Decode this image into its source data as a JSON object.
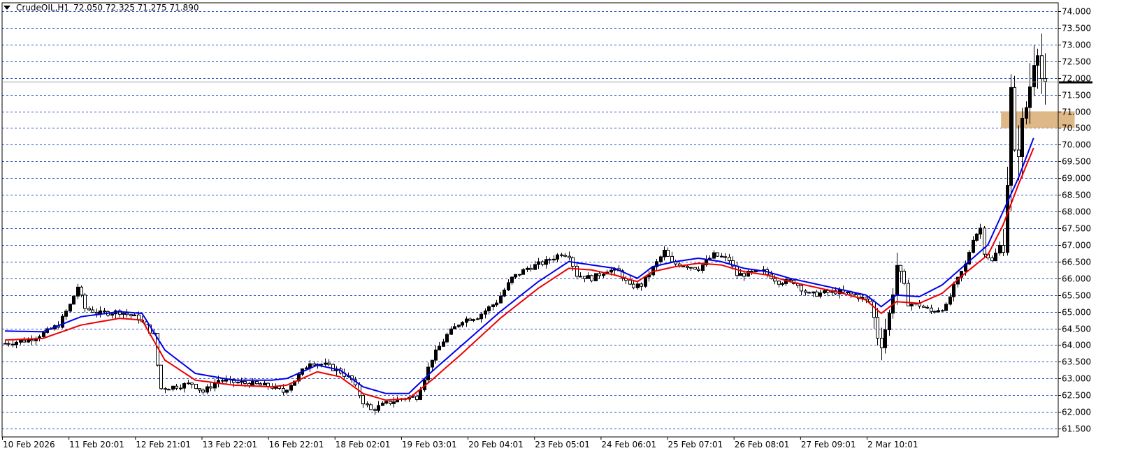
{
  "header": {
    "symbol": "CrudeOIL,H1",
    "ohlc": "72.050 72.325 71.275 71.890"
  },
  "chart_data": {
    "type": "candlestick",
    "symbol": "CrudeOIL",
    "timeframe": "H1",
    "ylim": [
      61.25,
      74.25
    ],
    "y_ticks": [
      "74.000",
      "73.500",
      "73.000",
      "72.500",
      "72.000",
      "71.500",
      "71.000",
      "70.500",
      "70.000",
      "69.500",
      "69.000",
      "68.500",
      "68.000",
      "67.500",
      "67.000",
      "66.500",
      "66.000",
      "65.500",
      "65.000",
      "64.500",
      "64.000",
      "63.500",
      "63.000",
      "62.500",
      "62.000",
      "61.500"
    ],
    "x_ticks": [
      "10 Feb 2026",
      "11 Feb 20:01",
      "12 Feb 21:01",
      "13 Feb 22:01",
      "16 Feb 22:01",
      "18 Feb 02:01",
      "19 Feb 03:01",
      "20 Feb 04:01",
      "23 Feb 05:01",
      "24 Feb 06:01",
      "25 Feb 07:01",
      "26 Feb 08:01",
      "27 Feb 09:01",
      "2 Mar 10:01"
    ],
    "grid": "horizontal dashed",
    "current_price": 71.89,
    "current_price_color": "#000000",
    "zone": {
      "from": 70.5,
      "to": 71.0,
      "start": "1 Mar 23:01",
      "end": "3 Mar 03:01",
      "color": "#deb887"
    },
    "price_path": [
      [
        0,
        64.05
      ],
      [
        6,
        64.15
      ],
      [
        10,
        64.35
      ],
      [
        14,
        64.6
      ],
      [
        17,
        65.2
      ],
      [
        19,
        65.75
      ],
      [
        21,
        65.1
      ],
      [
        25,
        64.95
      ],
      [
        30,
        65.0
      ],
      [
        35,
        64.8
      ],
      [
        39,
        64.3
      ],
      [
        40,
        63.4
      ],
      [
        41,
        62.7
      ],
      [
        44,
        62.75
      ],
      [
        49,
        62.85
      ],
      [
        52,
        62.6
      ],
      [
        56,
        62.95
      ],
      [
        59,
        62.9
      ],
      [
        64,
        62.85
      ],
      [
        70,
        62.75
      ],
      [
        73,
        62.6
      ],
      [
        76,
        62.95
      ],
      [
        80,
        63.5
      ],
      [
        84,
        63.4
      ],
      [
        88,
        63.2
      ],
      [
        91,
        62.95
      ],
      [
        94,
        62.3
      ],
      [
        96,
        62.05
      ],
      [
        100,
        62.25
      ],
      [
        104,
        62.4
      ],
      [
        108,
        62.45
      ],
      [
        112,
        63.6
      ],
      [
        116,
        64.3
      ],
      [
        120,
        64.75
      ],
      [
        124,
        64.85
      ],
      [
        129,
        65.3
      ],
      [
        133,
        66.0
      ],
      [
        137,
        66.3
      ],
      [
        142,
        66.5
      ],
      [
        146,
        66.75
      ],
      [
        148,
        66.7
      ],
      [
        150,
        66.1
      ],
      [
        154,
        66.0
      ],
      [
        158,
        66.25
      ],
      [
        161,
        66.2
      ],
      [
        164,
        65.75
      ],
      [
        167,
        65.8
      ],
      [
        170,
        66.3
      ],
      [
        173,
        66.8
      ],
      [
        175,
        66.45
      ],
      [
        178,
        66.4
      ],
      [
        182,
        66.3
      ],
      [
        186,
        66.7
      ],
      [
        190,
        66.55
      ],
      [
        192,
        66.1
      ],
      [
        196,
        66.15
      ],
      [
        199,
        66.2
      ],
      [
        203,
        65.9
      ],
      [
        207,
        65.9
      ],
      [
        211,
        65.5
      ],
      [
        214,
        65.55
      ],
      [
        218,
        65.6
      ],
      [
        223,
        65.5
      ],
      [
        227,
        65.3
      ],
      [
        229,
        64.3
      ],
      [
        230,
        64.1
      ],
      [
        232,
        64.9
      ],
      [
        234,
        66.4
      ],
      [
        237,
        65.25
      ],
      [
        240,
        65.2
      ],
      [
        243,
        65.0
      ],
      [
        247,
        65.15
      ],
      [
        249,
        65.75
      ],
      [
        252,
        66.4
      ],
      [
        254,
        67.2
      ],
      [
        256,
        67.5
      ],
      [
        257,
        66.8
      ],
      [
        259,
        66.5
      ],
      [
        262,
        67.2
      ],
      [
        263,
        69.0
      ],
      [
        264,
        71.5
      ],
      [
        265,
        69.5
      ],
      [
        267,
        70.5
      ],
      [
        269,
        71.8
      ],
      [
        270,
        72.7
      ],
      [
        271,
        73.1
      ],
      [
        272,
        72.0
      ],
      [
        273,
        71.89
      ]
    ],
    "ema_blue": [
      [
        0,
        64.42
      ],
      [
        10,
        64.4
      ],
      [
        20,
        64.85
      ],
      [
        30,
        65.0
      ],
      [
        36,
        64.95
      ],
      [
        42,
        63.85
      ],
      [
        50,
        63.15
      ],
      [
        60,
        62.95
      ],
      [
        70,
        62.95
      ],
      [
        74,
        63.0
      ],
      [
        82,
        63.4
      ],
      [
        88,
        63.25
      ],
      [
        94,
        62.75
      ],
      [
        100,
        62.55
      ],
      [
        106,
        62.55
      ],
      [
        112,
        63.2
      ],
      [
        120,
        64.0
      ],
      [
        130,
        65.0
      ],
      [
        140,
        65.9
      ],
      [
        148,
        66.5
      ],
      [
        154,
        66.4
      ],
      [
        160,
        66.3
      ],
      [
        166,
        66.0
      ],
      [
        170,
        66.35
      ],
      [
        176,
        66.5
      ],
      [
        182,
        66.6
      ],
      [
        188,
        66.5
      ],
      [
        194,
        66.3
      ],
      [
        200,
        66.2
      ],
      [
        206,
        66.0
      ],
      [
        214,
        65.8
      ],
      [
        220,
        65.65
      ],
      [
        226,
        65.5
      ],
      [
        230,
        65.15
      ],
      [
        234,
        65.5
      ],
      [
        240,
        65.45
      ],
      [
        246,
        65.8
      ],
      [
        252,
        66.4
      ],
      [
        258,
        67.0
      ],
      [
        262,
        68.0
      ],
      [
        266,
        69.0
      ],
      [
        270,
        70.2
      ]
    ],
    "ema_red": [
      [
        0,
        64.15
      ],
      [
        10,
        64.2
      ],
      [
        20,
        64.6
      ],
      [
        30,
        64.8
      ],
      [
        36,
        64.75
      ],
      [
        42,
        63.55
      ],
      [
        50,
        62.95
      ],
      [
        60,
        62.8
      ],
      [
        70,
        62.75
      ],
      [
        74,
        62.8
      ],
      [
        82,
        63.2
      ],
      [
        88,
        63.05
      ],
      [
        94,
        62.55
      ],
      [
        100,
        62.35
      ],
      [
        106,
        62.4
      ],
      [
        112,
        62.95
      ],
      [
        120,
        63.75
      ],
      [
        130,
        64.8
      ],
      [
        140,
        65.7
      ],
      [
        148,
        66.3
      ],
      [
        154,
        66.25
      ],
      [
        160,
        66.1
      ],
      [
        166,
        65.9
      ],
      [
        170,
        66.2
      ],
      [
        176,
        66.35
      ],
      [
        182,
        66.45
      ],
      [
        188,
        66.4
      ],
      [
        194,
        66.2
      ],
      [
        200,
        66.1
      ],
      [
        206,
        65.9
      ],
      [
        214,
        65.7
      ],
      [
        220,
        65.55
      ],
      [
        226,
        65.35
      ],
      [
        230,
        64.95
      ],
      [
        234,
        65.3
      ],
      [
        240,
        65.25
      ],
      [
        246,
        65.55
      ],
      [
        252,
        66.15
      ],
      [
        258,
        66.7
      ],
      [
        262,
        67.6
      ],
      [
        266,
        68.8
      ],
      [
        270,
        69.9
      ]
    ],
    "series": [
      {
        "name": "EMA (blue)",
        "color": "#0000ee"
      },
      {
        "name": "EMA (red)",
        "color": "#ee0000"
      }
    ]
  }
}
